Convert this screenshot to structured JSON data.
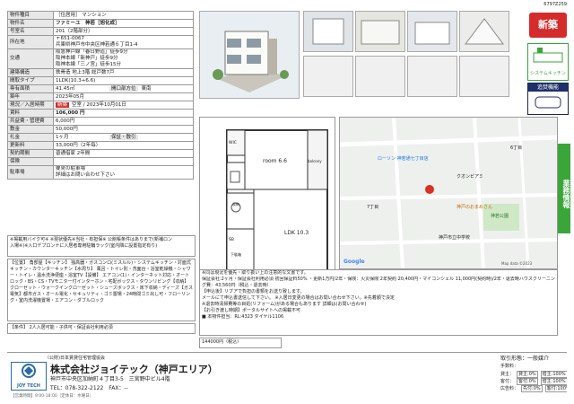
{
  "doc_id": "6797Z259",
  "spec": {
    "rows": [
      {
        "label": "物件種目",
        "value": "［住居用］ マンション"
      },
      {
        "label": "物件名",
        "value": "ファミーユ　神若［旭化成］"
      },
      {
        "label": "号室名",
        "value": "201（2階部分）"
      },
      {
        "label": "所在地",
        "value": "〒651-0067\n兵庫県神戸市中央区神若通６丁目1-4"
      },
      {
        "label": "交通",
        "value": "阪急神戸線「春日野道」徒歩9分\n阪神本線「新神戸」徒歩9分\n阪神本線「三ノ宮」徒歩15分"
      },
      {
        "label": "建築構造",
        "value": "鉄骨造 地上3階 総戸数7戸"
      },
      {
        "label": "間取タイプ",
        "value": "1LDK(10.3+6.6)"
      },
      {
        "label": "専有面積",
        "value": "41.45㎡",
        "extra_label": "開口部方位",
        "extra_value": "東南"
      },
      {
        "label": "築年",
        "value": "2023年05月"
      },
      {
        "label": "現況／入居時期",
        "badge": "新築",
        "value": "空室 / 2023年10月01日"
      },
      {
        "label": "賃料",
        "value": "106,000 円"
      },
      {
        "label": "共益費・管理費",
        "value": "6,000円"
      },
      {
        "label": "敷金",
        "value": "50,000円"
      },
      {
        "label": "礼金",
        "value": "1ヶ月",
        "extra_label": "保証・敷引",
        "extra_value": ""
      },
      {
        "label": "更新料",
        "value": "33,000円（2年毎）"
      },
      {
        "label": "契約期間",
        "value": "普通借家 2年間"
      },
      {
        "label": "保険",
        "value": ""
      },
      {
        "label": "駐車場",
        "value": "要見の駐車場\n詳細はお問い合わせ下さい"
      }
    ]
  },
  "notes": "※掲載用バイク可※ ※現状優先※当社・有担保※ 公館帳条件はありまで(新補ロン\n入場※)※入口デブロンナに入居者専用駐輪ラック(室内隣に設置指定有り)",
  "equipment": "【位置】 角部屋【キッチン】 独高器・ガスコンロ(ミスルル)・システムキッチン・対面式キッチン・カウンターキッチン【水周り】 風呂・トイレ別・洗面台・浴室乾燥機・シャワー・トイレ・温水洗浄便座・浴室TV【設備】 エアコン(1)・インターネット対応・オートロック・BS・CS・TVモニター付インターホン・宅配ボックス・タウンリビング【収納】 クローゼット・ウォークインクローゼット・シューズボックス・床下収納・ディーズ【ガス電気】都市ガス・オール電化・セキュリティ・ゴミ置場・24時間ゴミ出し可・フローリング・室内洗濯機置場・エアコン・ダブルロック",
  "conditions": "【条件】 2人入居可能・子供可・保証会社利用必須",
  "floorplan": {
    "rooms": [
      {
        "label": "room 6.6"
      },
      {
        "label": "balcony"
      },
      {
        "label": "LDK 10.3"
      },
      {
        "label": "WIC"
      },
      {
        "label": "SB"
      },
      {
        "label": "下駄箱"
      },
      {
        "label": "収納"
      }
    ]
  },
  "map": {
    "labels": [
      "ローソン 神若通七丁目店",
      "クオンビアミ",
      "神若公園",
      "7丁目",
      "6丁目",
      "神戸市立中学校",
      "神戸のおまめさん",
      "Google"
    ],
    "attribution": "Map data ©2023"
  },
  "side": {
    "new_badge": "新築",
    "system_kitchen": "システムキッチン",
    "bath": "追焚機能",
    "sales_vertical": "業務情報"
  },
  "remarks": {
    "title": "※同は現況を優先・取り扱い上の注意的な文書です。",
    "body": "保証会社:2ヶ月・保証会社利用必須 初回保証料50% ・更新1万円/2年・保険：火災保険 2年契約 20,400円・マイコンシェル 11,000円(契約時)/2年・退去時ハウスクリーニング費：43,560円（税込・退去時）\n【申込後】リブアで負担の書類をお送り致します。\nメールにて申込書送信して下さい。 ※入居日変更の場合はお問い合わせ下さい。※先着順で決定\n※退去時清掃費等の目処(リフォーム)がある場合もあります 詳細は(お問い合わせ)\n【お引き渡し時期】ポータルサイトへの掲載不可",
    "contact": "■ 本物件担当：RL:4323 ダイヤル1106",
    "fee": "144000円（税込）"
  },
  "company": {
    "license": "（公財)日本賃貸住宅管理協会",
    "logo": "JOY TECH",
    "name": "株式会社ジョイテック（神戸エリア）",
    "address": "神戸市中央区加納町４丁目3-5　三宮野中ビル4階",
    "tel": "TEL：078-322-2122　FAX：--"
  },
  "terms": {
    "title": "取引形態：一般媒介",
    "label": "手数料：",
    "rows": [
      {
        "k": "貸主：",
        "v": "貸主:0%",
        "v2": "借主:100%"
      },
      {
        "k": "客付：",
        "v": "客付:0%",
        "v2": "借主:100%"
      },
      {
        "k": "広告料：",
        "v": "先付:0%",
        "v2": "客付:100%"
      }
    ]
  },
  "footer": "【営業時間】9:00-18:00（定休日：水曜日）"
}
